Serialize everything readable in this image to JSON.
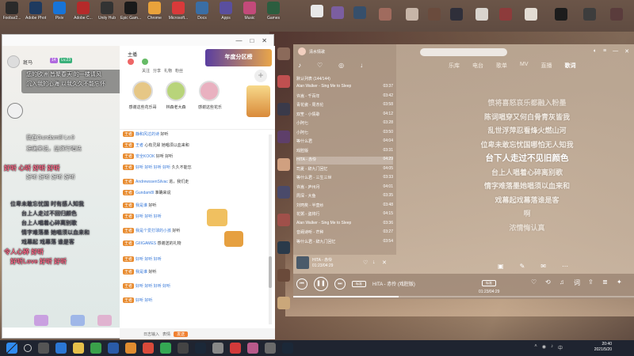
{
  "desktop": {
    "icons": [
      {
        "label": "Foobar2..."
      },
      {
        "label": "Adobe Photo..."
      },
      {
        "label": "Pixiv"
      },
      {
        "label": "Adobe C..."
      },
      {
        "label": "Unity Hub"
      },
      {
        "label": "Epic Gam..."
      },
      {
        "label": "Chrome"
      },
      {
        "label": "Microsoft..."
      },
      {
        "label": "Docs"
      },
      {
        "label": "Apps"
      },
      {
        "label": "Music"
      },
      {
        "label": "Games"
      }
    ]
  },
  "chat": {
    "window_controls": [
      "—",
      "□",
      "✕"
    ],
    "left_panel": {
      "username": "斑马",
      "badges": [
        "14",
        "Lv.23"
      ],
      "overlay_messages": [
        {
          "text": "您的欧洲 皆聚春天 的一楼请风"
        },
        {
          "text": "沉入我的心海 以我久久不能忘怀"
        },
        {
          "text": "我在Gundam8l Lv.9"
        },
        {
          "text": "准确来说，是演行唱法"
        },
        {
          "text": "好听 好听 好听 好听"
        },
        {
          "text": "位卑未敢忘忧国 时有感人知我"
        },
        {
          "text": "台上人走过不回归颜色"
        },
        {
          "text": "台上人唱着心碎离别歌"
        },
        {
          "text": "情字难落墨 她唱须以血来和"
        },
        {
          "text": "戏幕起 戏幕落 谁是客"
        }
      ],
      "highlight_messages": [
        {
          "text": "好听 心听 好听 好听"
        },
        {
          "text": "好听Love 好听 好听"
        },
        {
          "text": "令人心碎 好听"
        }
      ]
    },
    "top_panel": {
      "title": "主播",
      "tabs": [
        "关注",
        "分享",
        "礼物",
        "粉丝",
        "更多"
      ],
      "anchors": [
        {
          "name": "感谢这些花乐哥"
        },
        {
          "name": "林森老大森"
        },
        {
          "name": "感谢这些花乐"
        }
      ],
      "banner": "年度分区榜"
    },
    "list": {
      "rows": [
        {
          "tag": "王者",
          "user": "静和风过的诗",
          "msg": "好听"
        },
        {
          "tag": "王者",
          "user": "王者",
          "msg": "心有灵犀 她唱须以血来和"
        },
        {
          "tag": "王者",
          "user": "安全KOOK",
          "msg": "好听 好听"
        },
        {
          "tag": "王者",
          "user": "好听 好听 好听 好听",
          "msg": "久久不能忘"
        },
        {
          "tag": "王者",
          "user": "AndrewssenSilvac",
          "msg": "逃，我们走"
        },
        {
          "tag": "王者",
          "user": "Gundam8l",
          "msg": "准确来说"
        },
        {
          "tag": "王者",
          "user": "我是谁",
          "msg": "好听"
        },
        {
          "tag": "王者",
          "user": "好听 好听 好听",
          "msg": ""
        },
        {
          "tag": "王者",
          "user": "我是个爱打球的小孩",
          "msg": "好听"
        },
        {
          "tag": "王者",
          "user": "GIIIGAMES",
          "msg": "感谢送的礼物"
        },
        {
          "tag": "王者",
          "user": "好听 好听 好听",
          "msg": ""
        },
        {
          "tag": "王者",
          "user": "我是谁",
          "msg": "好听"
        },
        {
          "tag": "王者",
          "user": "好听 好听 好听 好听",
          "msg": ""
        },
        {
          "tag": "王者",
          "user": "好听 好听",
          "msg": ""
        }
      ]
    },
    "bottom_bar": {
      "items": [
        "日志输入",
        "表情",
        "发送"
      ]
    }
  },
  "music": {
    "title": "清水情歌",
    "nav": [
      "乐库",
      "电台",
      "歌单",
      "MV",
      "直播",
      "歌词"
    ],
    "active_nav": "歌词",
    "list_header": "默认列表 (144/144)",
    "songs": [
      {
        "name": "Alan Walker - Sing Me to Sleep",
        "time": "03:37"
      },
      {
        "name": "许嵩 - 千百年",
        "time": "03:42"
      },
      {
        "name": "青花瓷 - 周杰伦",
        "time": "03:58"
      },
      {
        "name": "双笙 - 小情歌",
        "time": "04:12"
      },
      {
        "name": "小阿七",
        "time": "03:28"
      },
      {
        "name": "小阿七",
        "time": "03:50"
      },
      {
        "name": "等什么君",
        "time": "04:04"
      },
      {
        "name": "戏腔版",
        "time": "03:31"
      },
      {
        "name": "HITA - 赤伶",
        "time": "04:29"
      },
      {
        "name": "司夏 - 辞九门回忆",
        "time": "04:05"
      },
      {
        "name": "等什么君 - 三生三世",
        "time": "03:33"
      },
      {
        "name": "许嵩 - 庐州月",
        "time": "04:01"
      },
      {
        "name": "周深 - 大鱼",
        "time": "03:35"
      },
      {
        "name": "刘珂矣 - 半壶纱",
        "time": "03:48"
      },
      {
        "name": "花粥 - 盗将行",
        "time": "04:15"
      },
      {
        "name": "Alan Walker - Sing Me to Sleep",
        "time": "03:36"
      },
      {
        "name": "音阙诗听 - 芒种",
        "time": "03:27"
      },
      {
        "name": "等什么君 - 辞九门回忆",
        "time": "03:54"
      }
    ],
    "active_song_index": 8,
    "lyrics": [
      "愤将喜怒哀乐都融入粉墨",
      "陈词唱穿又何白骨青灰皆我",
      "乱世浮萍忍看烽火燃山河",
      "位卑未敢忘忧国哪怕无人知我",
      "台下人走过不见旧颜色",
      "台上人唱着心碎离别歌",
      "情字难落墨她唱须以血来和",
      "戏幕起戏幕落谁是客",
      "啊",
      "浓情悔认真"
    ],
    "current_lyric_index": 4,
    "now_playing": {
      "title": "HITA - 赤伶",
      "time": "01:23/04:29"
    },
    "player": {
      "song": "HITA - 赤伶 (戏腔版)",
      "time": "01:23/04:29",
      "quality": "标准"
    },
    "progress": 0.31
  },
  "taskbar": {
    "time": "20:40",
    "date": "2021/5/20"
  }
}
